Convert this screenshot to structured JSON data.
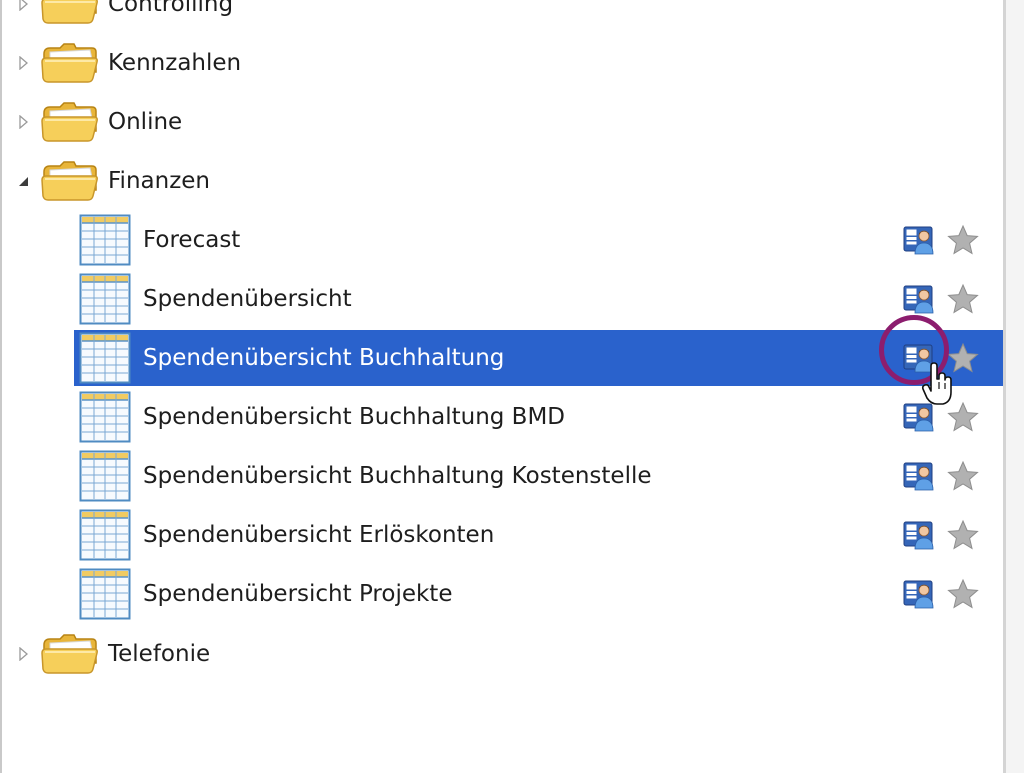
{
  "tree": {
    "folders": {
      "controlling": {
        "label": "Controlling",
        "expanded": false,
        "icon": "folder-icon"
      },
      "kennzahlen": {
        "label": "Kennzahlen",
        "expanded": false,
        "icon": "folder-icon"
      },
      "online": {
        "label": "Online",
        "expanded": false,
        "icon": "folder-icon"
      },
      "finanzen": {
        "label": "Finanzen",
        "expanded": true,
        "icon": "folder-open-icon"
      },
      "telefonie": {
        "label": "Telefonie",
        "expanded": false,
        "icon": "folder-icon"
      }
    },
    "finanzen_items": [
      {
        "label": "Forecast",
        "selected": false,
        "icon": "table-icon",
        "share_icon": "shared-report-icon",
        "favorite_icon": "star-icon"
      },
      {
        "label": "Spendenübersicht",
        "selected": false,
        "icon": "table-icon",
        "share_icon": "shared-report-icon",
        "favorite_icon": "star-icon"
      },
      {
        "label": "Spendenübersicht Buchhaltung",
        "selected": true,
        "icon": "table-icon",
        "share_icon": "shared-report-icon",
        "favorite_icon": "star-icon"
      },
      {
        "label": "Spendenübersicht Buchhaltung BMD",
        "selected": false,
        "icon": "table-icon",
        "share_icon": "shared-report-icon",
        "favorite_icon": "star-icon"
      },
      {
        "label": "Spendenübersicht Buchhaltung Kostenstelle",
        "selected": false,
        "icon": "table-icon",
        "share_icon": "shared-report-icon",
        "favorite_icon": "star-icon"
      },
      {
        "label": "Spendenübersicht Erlöskonten",
        "selected": false,
        "icon": "table-icon",
        "share_icon": "shared-report-icon",
        "favorite_icon": "star-icon"
      },
      {
        "label": "Spendenübersicht Projekte",
        "selected": false,
        "icon": "table-icon",
        "share_icon": "shared-report-icon",
        "favorite_icon": "star-icon"
      }
    ]
  },
  "colors": {
    "selection": "#2a62cc",
    "highlight_ring": "#8c1d6e",
    "folder": "#f2c94c",
    "star": "#a9a9a9"
  }
}
